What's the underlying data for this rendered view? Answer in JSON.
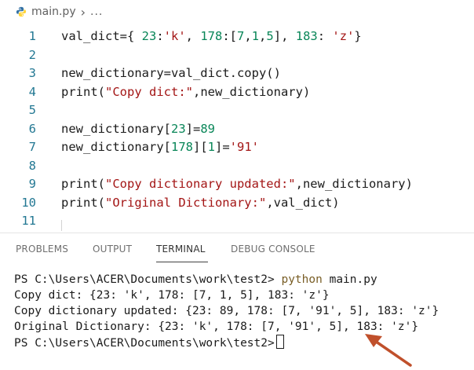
{
  "breadcrumb": {
    "file_name": "main.py",
    "separator": "›",
    "ellipsis": "..."
  },
  "editor": {
    "lines": [
      {
        "num": "1",
        "parts": [
          {
            "t": "val_dict={ "
          },
          {
            "t": "23",
            "c": "num"
          },
          {
            "t": ":"
          },
          {
            "t": "'k'",
            "c": "str"
          },
          {
            "t": ", "
          },
          {
            "t": "178",
            "c": "num"
          },
          {
            "t": ":["
          },
          {
            "t": "7",
            "c": "num"
          },
          {
            "t": ","
          },
          {
            "t": "1",
            "c": "num"
          },
          {
            "t": ","
          },
          {
            "t": "5",
            "c": "num"
          },
          {
            "t": "], "
          },
          {
            "t": "183",
            "c": "num"
          },
          {
            "t": ": "
          },
          {
            "t": "'z'",
            "c": "str"
          },
          {
            "t": "}"
          }
        ]
      },
      {
        "num": "2",
        "parts": []
      },
      {
        "num": "3",
        "parts": [
          {
            "t": "new_dictionary=val_dict.copy()"
          }
        ]
      },
      {
        "num": "4",
        "parts": [
          {
            "t": "print("
          },
          {
            "t": "\"Copy dict:\"",
            "c": "str"
          },
          {
            "t": ",new_dictionary)"
          }
        ]
      },
      {
        "num": "5",
        "parts": []
      },
      {
        "num": "6",
        "parts": [
          {
            "t": "new_dictionary["
          },
          {
            "t": "23",
            "c": "num"
          },
          {
            "t": "]="
          },
          {
            "t": "89",
            "c": "num"
          }
        ]
      },
      {
        "num": "7",
        "parts": [
          {
            "t": "new_dictionary["
          },
          {
            "t": "178",
            "c": "num"
          },
          {
            "t": "]["
          },
          {
            "t": "1",
            "c": "num"
          },
          {
            "t": "]="
          },
          {
            "t": "'91'",
            "c": "str"
          }
        ]
      },
      {
        "num": "8",
        "parts": []
      },
      {
        "num": "9",
        "parts": [
          {
            "t": "print("
          },
          {
            "t": "\"Copy dictionary updated:\"",
            "c": "str"
          },
          {
            "t": ",new_dictionary)"
          }
        ]
      },
      {
        "num": "10",
        "parts": [
          {
            "t": "print("
          },
          {
            "t": "\"Original Dictionary:\"",
            "c": "str"
          },
          {
            "t": ",val_dict)"
          }
        ]
      },
      {
        "num": "11",
        "parts": []
      }
    ]
  },
  "panel": {
    "tabs": [
      {
        "label": "PROBLEMS",
        "active": false
      },
      {
        "label": "OUTPUT",
        "active": false
      },
      {
        "label": "TERMINAL",
        "active": true
      },
      {
        "label": "DEBUG CONSOLE",
        "active": false
      }
    ]
  },
  "terminal": {
    "prompt": "PS C:\\Users\\ACER\\Documents\\work\\test2> ",
    "command_python": "python",
    "command_args": " main.py",
    "output": [
      "Copy dict: {23: 'k', 178: [7, 1, 5], 183: 'z'}",
      "Copy dictionary updated: {23: 89, 178: [7, '91', 5], 183: 'z'}",
      "Original Dictionary: {23: 'k', 178: [7, '91', 5], 183: 'z'}"
    ],
    "final_prompt": "PS C:\\Users\\ACER\\Documents\\work\\test2>"
  },
  "colors": {
    "string": "#a31515",
    "number": "#098658",
    "line_number": "#237893",
    "annotation_arrow": "#c0502b",
    "python_logo_blue": "#3572a5",
    "python_logo_yellow": "#ffd43b"
  },
  "icons": {
    "file": "python-file-icon",
    "annotation": "arrow-annotation"
  }
}
